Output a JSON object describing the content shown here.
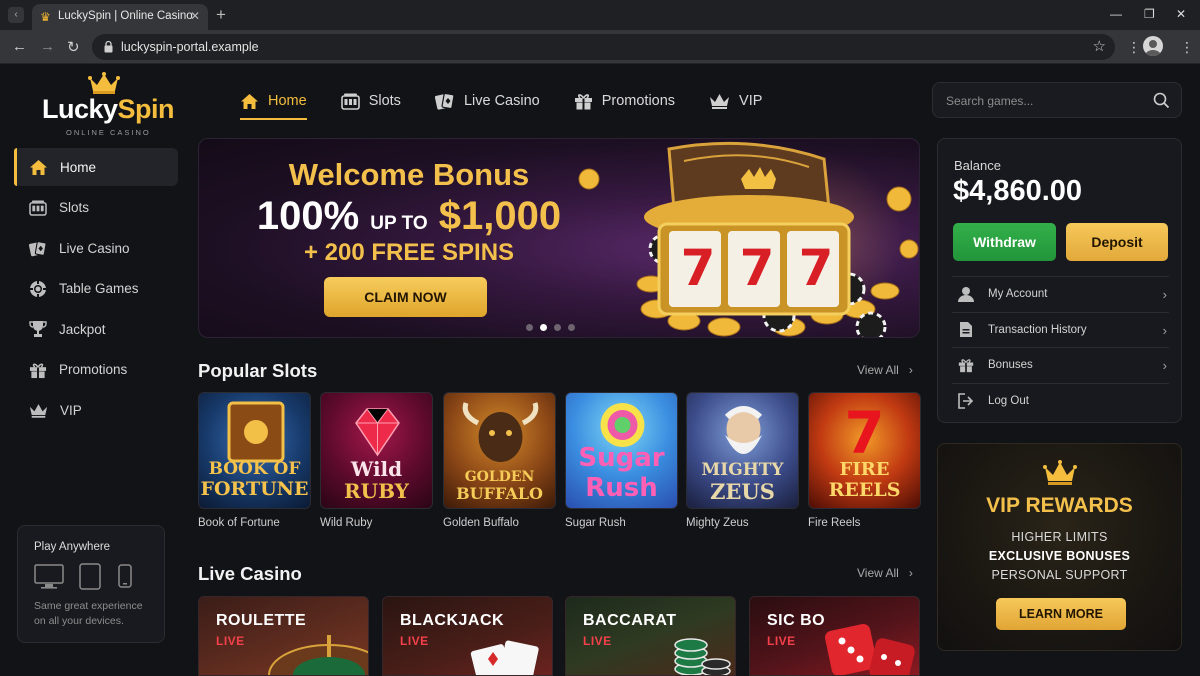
{
  "browser": {
    "tab_title": "LuckySpin | Online Casino",
    "url": "luckyspin-portal.example"
  },
  "logo": {
    "lucky": "Lucky",
    "spin": "Spin",
    "subtitle": "ONLINE CASINO"
  },
  "topnav": {
    "items": [
      {
        "label": "Home",
        "icon": "home-icon",
        "active": true
      },
      {
        "label": "Slots",
        "icon": "slot-machine-icon"
      },
      {
        "label": "Live Casino",
        "icon": "cards-icon"
      },
      {
        "label": "Promotions",
        "icon": "gift-icon"
      },
      {
        "label": "VIP",
        "icon": "crown-icon"
      }
    ]
  },
  "search": {
    "placeholder": "Search games..."
  },
  "sidebar": {
    "items": [
      {
        "label": "Home",
        "icon": "home-icon",
        "active": true
      },
      {
        "label": "Slots",
        "icon": "slot-machine-icon"
      },
      {
        "label": "Live Casino",
        "icon": "cards-icon"
      },
      {
        "label": "Table Games",
        "icon": "chip-icon"
      },
      {
        "label": "Jackpot",
        "icon": "trophy-icon"
      },
      {
        "label": "Promotions",
        "icon": "gift-icon"
      },
      {
        "label": "VIP",
        "icon": "crown-icon"
      }
    ],
    "play_card": {
      "title": "Play Anywhere",
      "description": "Same great experience on all your devices."
    }
  },
  "hero": {
    "title": "Welcome Bonus",
    "percent": "100%",
    "up_to": "UP TO",
    "amount": "$1,000",
    "spins": "+ 200 FREE SPINS",
    "cta": "CLAIM NOW",
    "reel_symbols": [
      "7",
      "7",
      "7"
    ],
    "slide_count": 4,
    "active_slide": 2
  },
  "popular_slots": {
    "title": "Popular Slots",
    "view_all": "View All",
    "games": [
      {
        "name": "Book of Fortune",
        "art_top": "BOOK OF",
        "art_bottom": "FORTUNE"
      },
      {
        "name": "Wild Ruby",
        "art_top": "Wild",
        "art_bottom": "RUBY"
      },
      {
        "name": "Golden Buffalo",
        "art_top": "GOLDEN",
        "art_bottom": "BUFFALO"
      },
      {
        "name": "Sugar Rush",
        "art_top": "Sugar",
        "art_bottom": "Rush"
      },
      {
        "name": "Mighty Zeus",
        "art_top": "MIGHTY",
        "art_bottom": "ZEUS"
      },
      {
        "name": "Fire Reels",
        "art_top": "FIRE",
        "art_bottom": "REELS"
      }
    ]
  },
  "live_casino": {
    "title": "Live Casino",
    "view_all": "View All",
    "games": [
      {
        "name": "ROULETTE",
        "tag": "LIVE"
      },
      {
        "name": "BLACKJACK",
        "tag": "LIVE"
      },
      {
        "name": "BACCARAT",
        "tag": "LIVE"
      },
      {
        "name": "SIC BO",
        "tag": "LIVE"
      }
    ]
  },
  "account": {
    "balance_label": "Balance",
    "balance_value": "$4,860.00",
    "withdraw": "Withdraw",
    "deposit": "Deposit",
    "menu": [
      {
        "label": "My Account",
        "icon": "user-icon"
      },
      {
        "label": "Transaction History",
        "icon": "document-icon"
      },
      {
        "label": "Bonuses",
        "icon": "gift-icon"
      },
      {
        "label": "Log Out",
        "icon": "logout-icon"
      }
    ]
  },
  "vip": {
    "title": "VIP REWARDS",
    "line1": "HIGHER LIMITS",
    "line2": "EXCLUSIVE BONUSES",
    "line3": "PERSONAL SUPPORT",
    "cta": "LEARN MORE"
  },
  "colors": {
    "accent_gold": "#f4bd3e",
    "withdraw_green": "#2aa142",
    "live_red": "#f3404a",
    "background": "#121317"
  }
}
